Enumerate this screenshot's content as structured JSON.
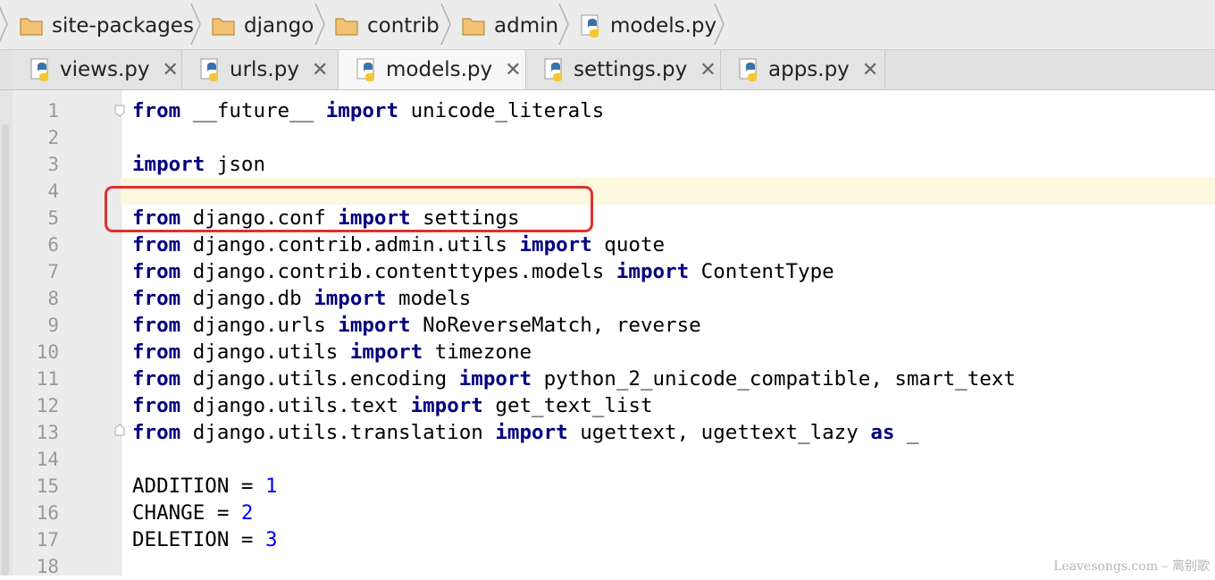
{
  "breadcrumb": [
    "site-packages",
    "django",
    "contrib",
    "admin",
    "models.py"
  ],
  "tabs": [
    {
      "label": "views.py",
      "active": false
    },
    {
      "label": "urls.py",
      "active": false
    },
    {
      "label": "models.py",
      "active": true
    },
    {
      "label": "settings.py",
      "active": false
    },
    {
      "label": "apps.py",
      "active": false
    }
  ],
  "tab_close_glyph": "✕",
  "editor": {
    "caret_line": 4,
    "highlighted_line": 5,
    "lines": [
      {
        "no": "1",
        "tokens": [
          [
            "kw",
            "from"
          ],
          [
            "t",
            " __future__ "
          ],
          [
            "kw",
            "import"
          ],
          [
            "t",
            " unicode_literals"
          ]
        ]
      },
      {
        "no": "2",
        "tokens": []
      },
      {
        "no": "3",
        "tokens": [
          [
            "kw",
            "import"
          ],
          [
            "t",
            " json"
          ]
        ]
      },
      {
        "no": "4",
        "tokens": []
      },
      {
        "no": "5",
        "tokens": [
          [
            "kw",
            "from"
          ],
          [
            "t",
            " django.conf "
          ],
          [
            "kw",
            "import"
          ],
          [
            "t",
            " settings"
          ]
        ]
      },
      {
        "no": "6",
        "tokens": [
          [
            "kw",
            "from"
          ],
          [
            "t",
            " django.contrib.admin.utils "
          ],
          [
            "kw",
            "import"
          ],
          [
            "t",
            " quote"
          ]
        ]
      },
      {
        "no": "7",
        "tokens": [
          [
            "kw",
            "from"
          ],
          [
            "t",
            " django.contrib.contenttypes.models "
          ],
          [
            "kw",
            "import"
          ],
          [
            "t",
            " ContentType"
          ]
        ]
      },
      {
        "no": "8",
        "tokens": [
          [
            "kw",
            "from"
          ],
          [
            "t",
            " django.db "
          ],
          [
            "kw",
            "import"
          ],
          [
            "t",
            " models"
          ]
        ]
      },
      {
        "no": "9",
        "tokens": [
          [
            "kw",
            "from"
          ],
          [
            "t",
            " django.urls "
          ],
          [
            "kw",
            "import"
          ],
          [
            "t",
            " NoReverseMatch, reverse"
          ]
        ]
      },
      {
        "no": "10",
        "tokens": [
          [
            "kw",
            "from"
          ],
          [
            "t",
            " django.utils "
          ],
          [
            "kw",
            "import"
          ],
          [
            "t",
            " timezone"
          ]
        ]
      },
      {
        "no": "11",
        "tokens": [
          [
            "kw",
            "from"
          ],
          [
            "t",
            " django.utils.encoding "
          ],
          [
            "kw",
            "import"
          ],
          [
            "t",
            " python_2_unicode_compatible, smart_text"
          ]
        ]
      },
      {
        "no": "12",
        "tokens": [
          [
            "kw",
            "from"
          ],
          [
            "t",
            " django.utils.text "
          ],
          [
            "kw",
            "import"
          ],
          [
            "t",
            " get_text_list"
          ]
        ]
      },
      {
        "no": "13",
        "tokens": [
          [
            "kw",
            "from"
          ],
          [
            "t",
            " django.utils.translation "
          ],
          [
            "kw",
            "import"
          ],
          [
            "t",
            " ugettext, ugettext_lazy "
          ],
          [
            "kw",
            "as"
          ],
          [
            "t",
            " _"
          ]
        ]
      },
      {
        "no": "14",
        "tokens": []
      },
      {
        "no": "15",
        "tokens": [
          [
            "t",
            "ADDITION = "
          ],
          [
            "num",
            "1"
          ]
        ]
      },
      {
        "no": "16",
        "tokens": [
          [
            "t",
            "CHANGE = "
          ],
          [
            "num",
            "2"
          ]
        ]
      },
      {
        "no": "17",
        "tokens": [
          [
            "t",
            "DELETION = "
          ],
          [
            "num",
            "3"
          ]
        ]
      },
      {
        "no": "18",
        "tokens": []
      }
    ]
  },
  "colors": {
    "keyword": "#000080",
    "number": "#0000ff",
    "highlight_box": "#e0302c",
    "caret_row": "#fcf8e0"
  },
  "watermark": "Leavesongs.com – 离别歌"
}
